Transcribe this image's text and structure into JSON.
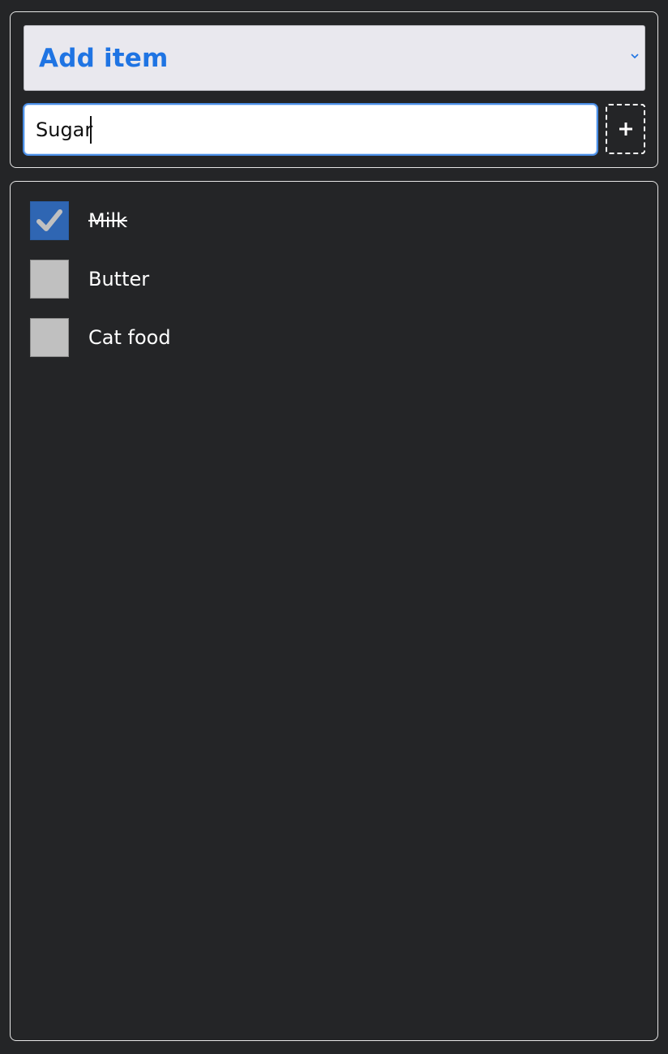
{
  "header": {
    "title": "Add item",
    "chevron_icon": "chevron-down-icon"
  },
  "input": {
    "value": "Sugar",
    "placeholder": ""
  },
  "add_button": {
    "icon": "plus-icon"
  },
  "items": [
    {
      "label": "Milk",
      "checked": true
    },
    {
      "label": "Butter",
      "checked": false
    },
    {
      "label": "Cat food",
      "checked": false
    }
  ],
  "colors": {
    "background": "#242527",
    "accent": "#1f74e3",
    "checked_box": "#2f66b3",
    "unchecked_box": "#c0c0c0"
  }
}
